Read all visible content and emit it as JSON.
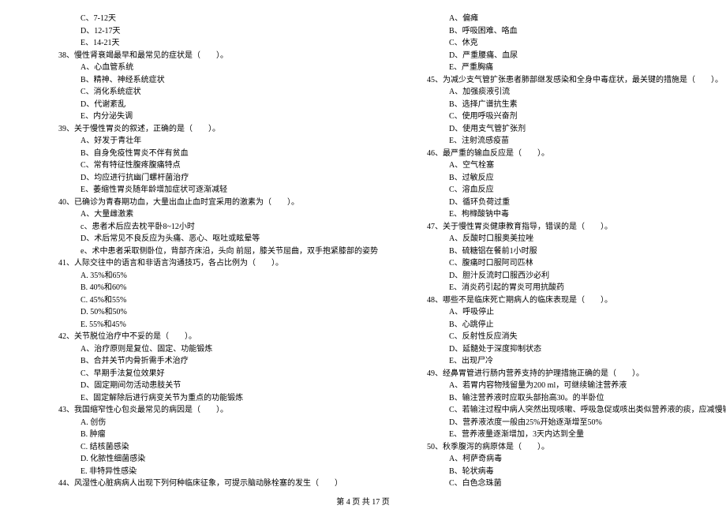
{
  "footer": "第 4 页 共 17 页",
  "left": [
    {
      "t": "C、7-12天",
      "c": "indent2"
    },
    {
      "t": "D、12-17天",
      "c": "indent2"
    },
    {
      "t": "E、14-21天",
      "c": "indent2"
    },
    {
      "t": "38、慢性肾衰竭最早和最常见的症状是（　　）。",
      "c": "q"
    },
    {
      "t": "A、心血管系统",
      "c": "indent2"
    },
    {
      "t": "B、精神、神经系统症状",
      "c": "indent2"
    },
    {
      "t": "C、消化系统症状",
      "c": "indent2"
    },
    {
      "t": "D、代谢紊乱",
      "c": "indent2"
    },
    {
      "t": "E、内分泌失调",
      "c": "indent2"
    },
    {
      "t": "39、关于慢性胃炎的叙述，正确的是（　　）。",
      "c": "q"
    },
    {
      "t": "A、好发于青壮年",
      "c": "indent2"
    },
    {
      "t": "B、自身免疫性胃炎不伴有贫血",
      "c": "indent2"
    },
    {
      "t": "C、常有特征性腹疼腹痛特点",
      "c": "indent2"
    },
    {
      "t": "D、均应进行抗幽门螺杆菌治疗",
      "c": "indent2"
    },
    {
      "t": "E、萎缩性胃炎随年龄增加症状可逐渐减轻",
      "c": "indent2"
    },
    {
      "t": "40、已确诊为青春期功血，大量出血止血时宜采用的激素为（　　）。",
      "c": "q"
    },
    {
      "t": "A、大量雌激素",
      "c": "indent2"
    },
    {
      "t": "c、患者术后应去枕平卧8~12小时",
      "c": "indent2"
    },
    {
      "t": "D、术后常见不良反应为头痛、恶心、呕吐或眩晕等",
      "c": "indent2"
    },
    {
      "t": "e、术中患者采取侧卧位，背部齐床沿，头向 前屈，膝关节屈曲，双手抱紧膝部的姿势",
      "c": "indent2"
    },
    {
      "t": "41、人际交往中的语言和非语言沟通技巧，各占比例为（　　）。",
      "c": "q"
    },
    {
      "t": "A. 35%和65%",
      "c": "indent2"
    },
    {
      "t": "B. 40%和60%",
      "c": "indent2"
    },
    {
      "t": "C. 45%和55%",
      "c": "indent2"
    },
    {
      "t": "D. 50%和50%",
      "c": "indent2"
    },
    {
      "t": "E. 55%和45%",
      "c": "indent2"
    },
    {
      "t": "42、关节脱位治疗中不妥的是（　　）。",
      "c": "q"
    },
    {
      "t": "A、治疗原则是复位、固定、功能锻炼",
      "c": "indent2"
    },
    {
      "t": "B、合并关节内骨折需手术治疗",
      "c": "indent2"
    },
    {
      "t": "C、早期手法复位效果好",
      "c": "indent2"
    },
    {
      "t": "D、固定期间勿活动患肢关节",
      "c": "indent2"
    },
    {
      "t": "E、固定解除后进行病变关节为重点的功能锻炼",
      "c": "indent2"
    },
    {
      "t": "43、我国缩窄性心包炎最常见的病因是（　　）。",
      "c": "q"
    },
    {
      "t": "A. 创伤",
      "c": "indent2"
    },
    {
      "t": "B. 肿瘤",
      "c": "indent2"
    },
    {
      "t": "C. 结核菌感染",
      "c": "indent2"
    },
    {
      "t": "D. 化脓性细菌感染",
      "c": "indent2"
    },
    {
      "t": "E. 非特异性感染",
      "c": "indent2"
    },
    {
      "t": "44、风湿性心脏病病人出现下列何种临床征象，可提示脑动脉栓塞的发生（　　）",
      "c": "q"
    }
  ],
  "right": [
    {
      "t": "A、偏瘫",
      "c": "indent2"
    },
    {
      "t": "B、呼吸困难、咯血",
      "c": "indent2"
    },
    {
      "t": "C、休克",
      "c": "indent2"
    },
    {
      "t": "D、严重腰痛、血尿",
      "c": "indent2"
    },
    {
      "t": "E、严重胸痛",
      "c": "indent2"
    },
    {
      "t": "45、为减少支气管扩张患者肺部继发感染和全身中毒症状，最关键的措施是（　　）。",
      "c": "q"
    },
    {
      "t": "A、加强痰液引流",
      "c": "indent2"
    },
    {
      "t": "B、选择广谱抗生素",
      "c": "indent2"
    },
    {
      "t": "C、使用呼吸兴奋剂",
      "c": "indent2"
    },
    {
      "t": "D、使用支气管扩张剂",
      "c": "indent2"
    },
    {
      "t": "E、注射流感疫苗",
      "c": "indent2"
    },
    {
      "t": "46、最严重的输血反应是（　　）。",
      "c": "q"
    },
    {
      "t": "A、空气栓塞",
      "c": "indent2"
    },
    {
      "t": "B、过敏反应",
      "c": "indent2"
    },
    {
      "t": "C、溶血反应",
      "c": "indent2"
    },
    {
      "t": "D、循环负荷过重",
      "c": "indent2"
    },
    {
      "t": "E、枸橼酸钠中毒",
      "c": "indent2"
    },
    {
      "t": "47、关于慢性胃炎健康教育指导，错误的是（　　）。",
      "c": "q"
    },
    {
      "t": "A、反酸时口服奥美拉唑",
      "c": "indent2"
    },
    {
      "t": "B、硫糖铝在餐前1小时服",
      "c": "indent2"
    },
    {
      "t": "C、腹痛时口服阿司匹林",
      "c": "indent2"
    },
    {
      "t": "D、胆汁反流时口服西沙必利",
      "c": "indent2"
    },
    {
      "t": "E、消炎药引起的胃炎可用抗酸药",
      "c": "indent2"
    },
    {
      "t": "48、哪些不是临床死亡期病人的临床表现是（　　）。",
      "c": "q"
    },
    {
      "t": "A、呼吸停止",
      "c": "indent2"
    },
    {
      "t": "B、心跳停止",
      "c": "indent2"
    },
    {
      "t": "C、反射性反应消失",
      "c": "indent2"
    },
    {
      "t": "D、延髓处于深度抑制状态",
      "c": "indent2"
    },
    {
      "t": "E、出现尸冷",
      "c": "indent2"
    },
    {
      "t": "49、经鼻胃管进行肠内营养支持的护理措施正确的是（　　）。",
      "c": "q"
    },
    {
      "t": "A、若胃内容物残留量为200 ml，可继续输注营养液",
      "c": "indent2"
    },
    {
      "t": "B、输注营养液时应取头部抬高30。的半卧位",
      "c": "indent2"
    },
    {
      "t": "C、若输注过程中病人突然出现咳嗽、呼吸急促或咳出类似营养液的痰，应减慢输注速度",
      "c": "indent2"
    },
    {
      "t": "D、营养液浓度一般由25%开始逐渐增至50%",
      "c": "indent2"
    },
    {
      "t": "E、营养液量逐渐增加，3天内达到全量",
      "c": "indent2"
    },
    {
      "t": "50、秋季腹泻的病原体是（　　）。",
      "c": "q"
    },
    {
      "t": "A、柯萨奇病毒",
      "c": "indent2"
    },
    {
      "t": "B、轮状病毒",
      "c": "indent2"
    },
    {
      "t": "C、白色念珠菌",
      "c": "indent2"
    }
  ]
}
